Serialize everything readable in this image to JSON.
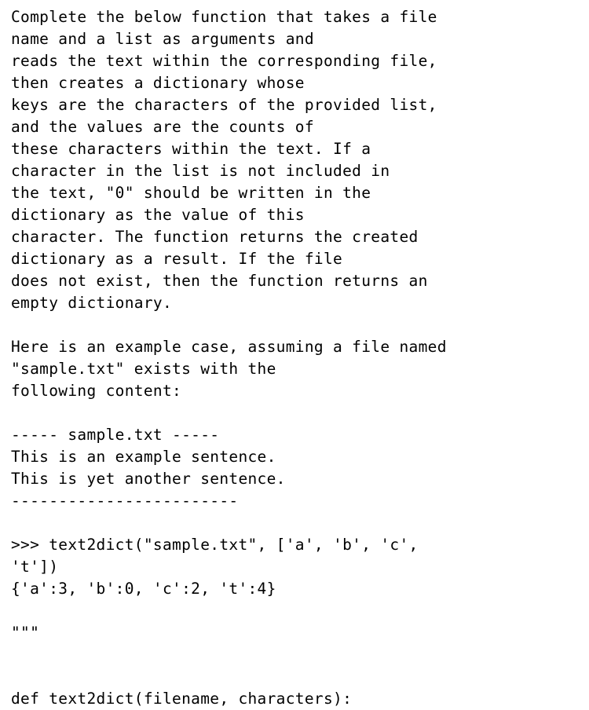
{
  "document": {
    "kind": "python-docstring",
    "background_color": "#ffffff",
    "text_color": "#000000",
    "lines": [
      "Complete the below function that takes a file",
      "name and a list as arguments and",
      "reads the text within the corresponding file,",
      "then creates a dictionary whose",
      "keys are the characters of the provided list,",
      "and the values are the counts of",
      "these characters within the text. If a",
      "character in the list is not included in",
      "the text, \"0\" should be written in the",
      "dictionary as the value of this",
      "character. The function returns the created",
      "dictionary as a result. If the file",
      "does not exist, then the function returns an",
      "empty dictionary.",
      "",
      "Here is an example case, assuming a file named",
      "\"sample.txt\" exists with the",
      "following content:",
      "",
      "----- sample.txt -----",
      "This is an example sentence.",
      "This is yet another sentence.",
      "------------------------",
      "",
      ">>> text2dict(\"sample.txt\", ['a', 'b', 'c',",
      "'t'])",
      "{'a':3, 'b':0, 'c':2, 't':4}",
      "",
      "\"\"\"",
      "",
      "",
      "def text2dict(filename, characters):"
    ],
    "example": {
      "sample_file_name": "sample.txt",
      "sample_file_header": "----- sample.txt -----",
      "sample_file_footer": "------------------------",
      "sample_file_content": [
        "This is an example sentence.",
        "This is yet another sentence."
      ],
      "repl_prompt": ">>>",
      "repl_call": "text2dict(\"sample.txt\", ['a', 'b', 'c', 't'])",
      "repl_result": "{'a':3, 'b':0, 'c':2, 't':4}",
      "characters": [
        "a",
        "b",
        "c",
        "t"
      ],
      "counts": [
        3,
        0,
        2,
        4
      ]
    },
    "code": {
      "docstring_terminator": "\"\"\"",
      "signature": "def text2dict(filename, characters):",
      "function_name": "text2dict",
      "parameters": [
        "filename",
        "characters"
      ]
    }
  }
}
